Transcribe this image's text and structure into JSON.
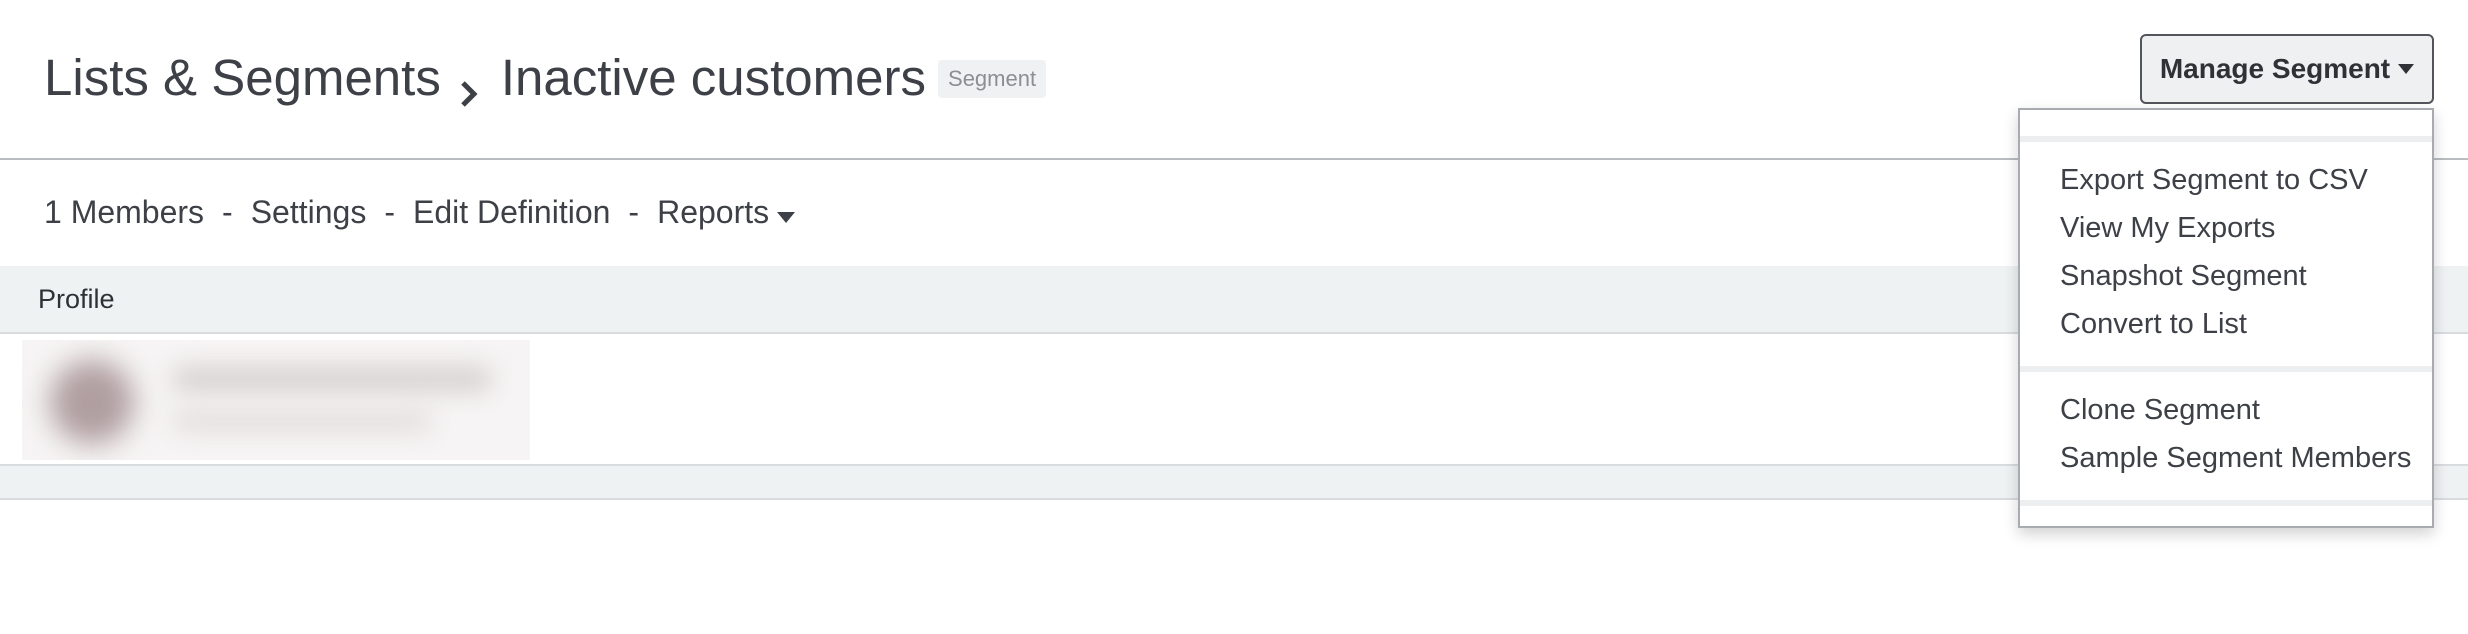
{
  "header": {
    "breadcrumb_parent": "Lists & Segments",
    "breadcrumb_current": "Inactive customers",
    "badge": "Segment",
    "manage_button_label": "Manage Segment"
  },
  "subnav": {
    "members": "1 Members",
    "settings": "Settings",
    "edit_definition": "Edit Definition",
    "reports": "Reports",
    "separator": "-"
  },
  "table": {
    "columns": [
      "Profile"
    ]
  },
  "dropdown": {
    "group1": [
      "Export Segment to CSV",
      "View My Exports",
      "Snapshot Segment",
      "Convert to List"
    ],
    "group2": [
      "Clone Segment",
      "Sample Segment Members"
    ]
  },
  "icons": {
    "breadcrumb_separator": "chevron-right-icon",
    "dropdown_caret": "caret-down-icon"
  },
  "colors": {
    "text": "#3d4046",
    "table_header_bg": "#eff2f3",
    "button_bg": "#eef0f1",
    "badge_bg": "#f0f1f2"
  }
}
